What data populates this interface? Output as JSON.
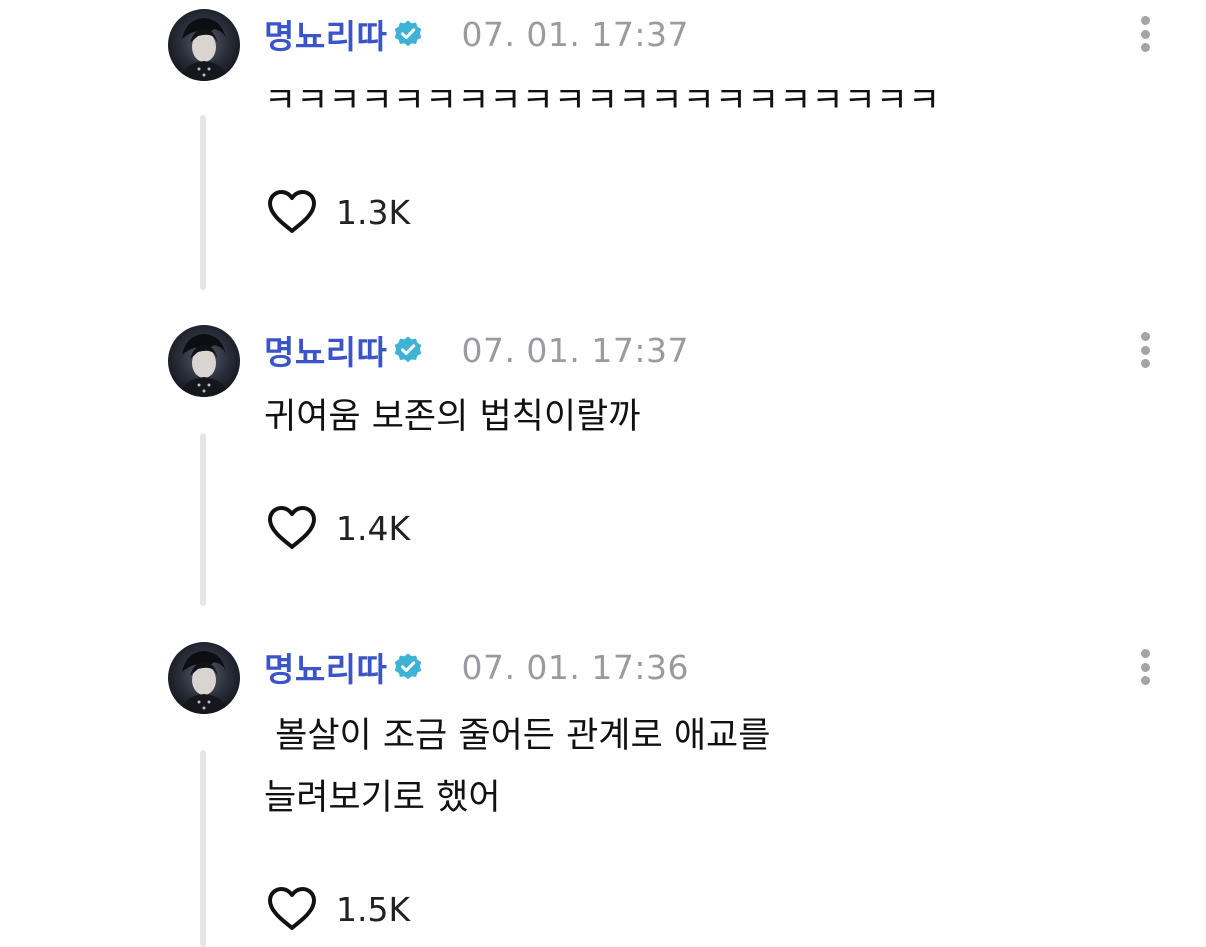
{
  "posts": [
    {
      "username": "명뇨리따",
      "timestamp": "07. 01. 17:37",
      "text": "ㅋㅋㅋㅋㅋㅋㅋㅋㅋㅋㅋㅋㅋㅋㅋㅋㅋㅋㅋㅋㅋ",
      "likes": "1.3K"
    },
    {
      "username": "명뇨리따",
      "timestamp": "07. 01. 17:37",
      "text": "귀여움 보존의 법칙이랄까",
      "likes": "1.4K"
    },
    {
      "username": "명뇨리따",
      "timestamp": "07. 01. 17:36",
      "text": " 볼살이 조금 줄어든 관계로 애교를\n늘려보기로 했어",
      "likes": "1.5K"
    }
  ],
  "icons": {
    "verified": "verified-badge-icon",
    "more": "more-vertical-icon",
    "like": "heart-outline-icon"
  },
  "colors": {
    "username": "#3b55c9",
    "verified_badge": "#3fb3d6",
    "timestamp": "#9a9aa0",
    "thread_line": "#e6e6e9",
    "text": "#111111"
  }
}
